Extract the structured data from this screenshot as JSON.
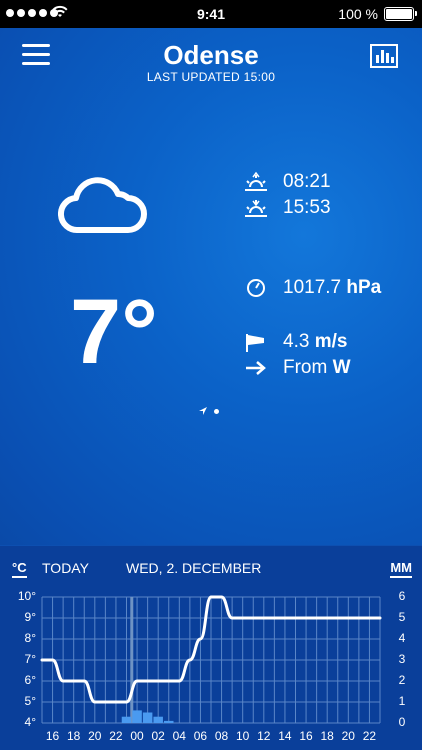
{
  "status_bar": {
    "time": "9:41",
    "battery": "100 %"
  },
  "header": {
    "city": "Odense",
    "updated": "LAST UPDATED 15:00"
  },
  "current": {
    "temperature": "7°",
    "condition_icon": "cloud-icon",
    "sunrise": "08:21",
    "sunset": "15:53",
    "pressure_value": "1017.7",
    "pressure_unit": "hPa",
    "wind_speed": "4.3",
    "wind_unit": "m/s",
    "wind_dir_prefix": "From",
    "wind_dir": "W"
  },
  "forecast": {
    "unit_left": "°C",
    "unit_right": "MM",
    "today": "TODAY",
    "date": "WED, 2. DECEMBER",
    "y_left_ticks": [
      "10°",
      "9°",
      "8°",
      "7°",
      "6°",
      "5°",
      "4°"
    ],
    "y_right_ticks": [
      "6",
      "5",
      "4",
      "3",
      "2",
      "1",
      "0"
    ],
    "x_ticks": [
      "16",
      "18",
      "20",
      "22",
      "00",
      "02",
      "04",
      "06",
      "08",
      "10",
      "12",
      "14",
      "16",
      "18",
      "20",
      "22"
    ]
  },
  "chart_data": {
    "type": "line",
    "x": [
      "15",
      "16",
      "17",
      "18",
      "19",
      "20",
      "21",
      "22",
      "23",
      "00",
      "01",
      "02",
      "03",
      "04",
      "05",
      "06",
      "07",
      "08",
      "09",
      "10",
      "11",
      "12",
      "13",
      "14",
      "15",
      "16",
      "17",
      "18",
      "19",
      "20",
      "21",
      "22",
      "23"
    ],
    "series": [
      {
        "values": [
          7,
          7,
          6,
          6,
          6,
          5,
          5,
          5,
          5,
          6,
          6,
          6,
          6,
          6,
          7,
          8,
          10,
          10,
          9,
          9,
          9,
          9,
          9,
          9,
          9,
          9,
          9,
          9,
          9,
          9,
          9,
          9,
          9
        ]
      }
    ],
    "precipitation": {
      "x": [
        "23",
        "00",
        "01",
        "02",
        "03"
      ],
      "values": [
        0.3,
        0.6,
        0.5,
        0.3,
        0.1
      ]
    },
    "ylim": [
      4,
      10
    ],
    "y2lim": [
      0,
      6
    ],
    "grid": true,
    "colors": {
      "line": "#ffffff",
      "precip": "#4a9af0",
      "grid": "#5a86c8"
    }
  }
}
